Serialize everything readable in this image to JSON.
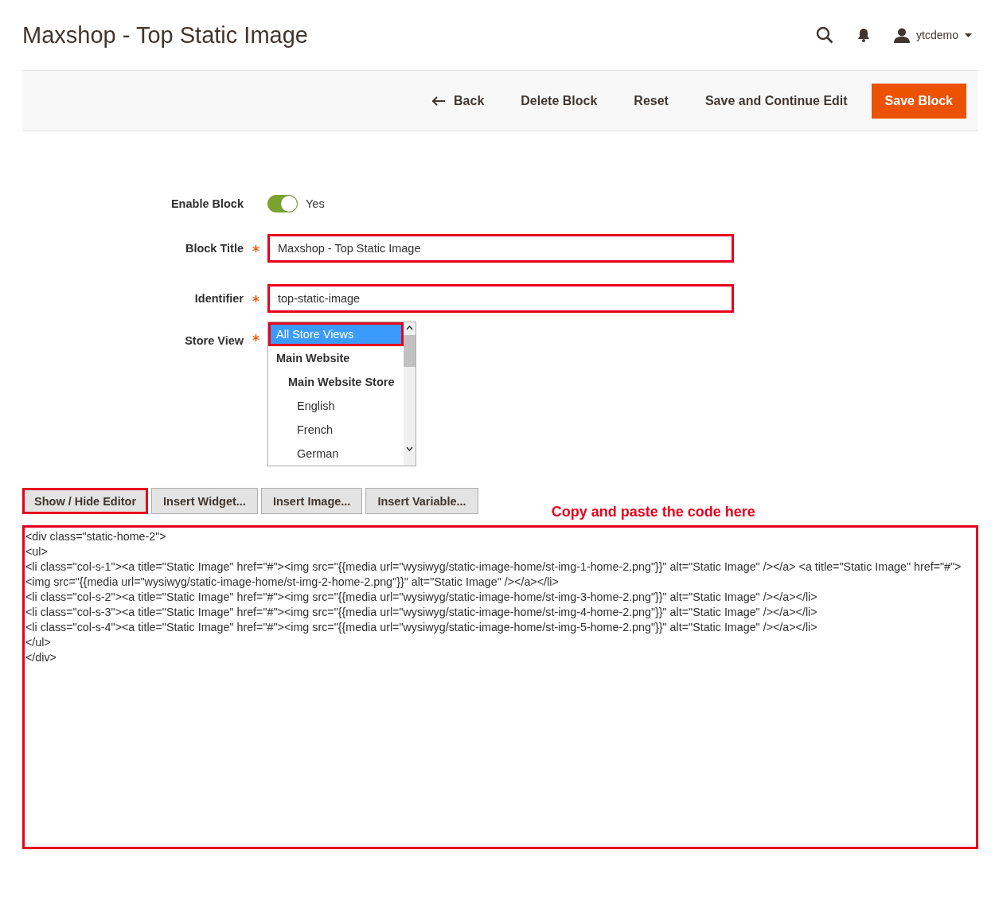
{
  "header": {
    "title": "Maxshop - Top Static Image",
    "user": "ytcdemo"
  },
  "actions": [
    {
      "kind": "back",
      "label": "Back"
    },
    {
      "kind": "plain",
      "label": "Delete Block"
    },
    {
      "kind": "plain",
      "label": "Reset"
    },
    {
      "kind": "plain",
      "label": "Save and Continue Edit"
    },
    {
      "kind": "primary",
      "label": "Save Block"
    }
  ],
  "form": {
    "enable_block": {
      "label": "Enable Block",
      "on": true,
      "value_label": "Yes"
    },
    "fields": [
      {
        "label": "Block Title",
        "required": true,
        "value": "Maxshop - Top Static Image",
        "highlighted": true
      },
      {
        "label": "Identifier",
        "required": true,
        "value": "top-static-image",
        "highlighted": true
      }
    ],
    "store_view": {
      "label": "Store View",
      "required": true,
      "options": [
        {
          "label": "All Store Views",
          "selected": true,
          "highlighted": true
        },
        {
          "label": "Main Website",
          "selected": false,
          "highlighted": false,
          "children": [
            {
              "label": "Main Website Store",
              "selected": false,
              "highlighted": false,
              "children": [
                {
                  "label": "English",
                  "selected": false,
                  "highlighted": false
                },
                {
                  "label": "French",
                  "selected": false,
                  "highlighted": false
                },
                {
                  "label": "German",
                  "selected": false,
                  "highlighted": false
                }
              ]
            }
          ]
        }
      ]
    }
  },
  "editor": {
    "buttons": [
      {
        "label": "Show / Hide Editor",
        "highlighted": true
      },
      {
        "label": "Insert Widget...",
        "highlighted": false
      },
      {
        "label": "Insert Image...",
        "highlighted": false
      },
      {
        "label": "Insert Variable...",
        "highlighted": false
      }
    ],
    "annotation": "Copy and paste the code here",
    "highlighted": true,
    "lines": [
      "<div class=\"static-home-2\">",
      "<ul>",
      "<li class=\"col-s-1\"><a title=\"Static Image\" href=\"#\"><img src=\"{{media url=\"wysiwyg/static-image-home/st-img-1-home-2.png\"}}\" alt=\"Static Image\" /></a> <a title=\"Static Image\" href=\"#\"><img src=\"{{media url=\"wysiwyg/static-image-home/st-img-2-home-2.png\"}}\" alt=\"Static Image\" /></a></li>",
      "<li class=\"col-s-2\"><a title=\"Static Image\" href=\"#\"><img src=\"{{media url=\"wysiwyg/static-image-home/st-img-3-home-2.png\"}}\" alt=\"Static Image\" /></a></li>",
      "<li class=\"col-s-3\"><a title=\"Static Image\" href=\"#\"><img src=\"{{media url=\"wysiwyg/static-image-home/st-img-4-home-2.png\"}}\" alt=\"Static Image\" /></a></li>",
      "<li class=\"col-s-4\"><a title=\"Static Image\" href=\"#\"><img src=\"{{media url=\"wysiwyg/static-image-home/st-img-5-home-2.png\"}}\" alt=\"Static Image\" /></a></li>",
      "</ul>",
      "</div>"
    ]
  }
}
